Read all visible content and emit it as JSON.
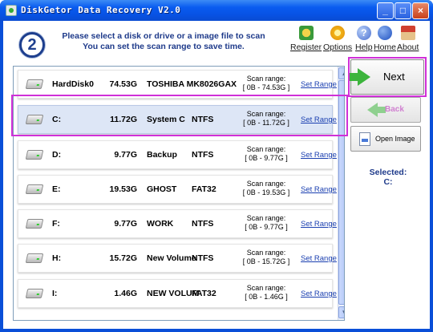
{
  "window": {
    "title": "DiskGetor Data Recovery V2.0",
    "controls": {
      "minimize": "_",
      "maximize": "□",
      "close": "×"
    }
  },
  "header": {
    "step_number": "2",
    "instructions": [
      "Please select a disk or drive or a image file to scan",
      "You can set the scan range to save time."
    ]
  },
  "menu": [
    {
      "label": "Register",
      "icon": "register-icon"
    },
    {
      "label": "Options",
      "icon": "options-icon"
    },
    {
      "label": "Help",
      "icon": "help-icon"
    },
    {
      "label": "Home",
      "icon": "home-icon"
    },
    {
      "label": "About",
      "icon": "about-icon"
    }
  ],
  "scan_range_label": "Scan range:",
  "set_range_label": "Set Range",
  "drives": [
    {
      "name": "HardDisk0",
      "size": "74.53G",
      "label": "TOSHIBA MK8026GAX",
      "fs": "",
      "range": "[ 0B - 74.53G ]"
    },
    {
      "name": "C:",
      "size": "11.72G",
      "label": "System C",
      "fs": "NTFS",
      "range": "[ 0B - 11.72G ]"
    },
    {
      "name": "D:",
      "size": "9.77G",
      "label": "Backup",
      "fs": "NTFS",
      "range": "[ 0B - 9.77G ]"
    },
    {
      "name": "E:",
      "size": "19.53G",
      "label": "GHOST",
      "fs": "FAT32",
      "range": "[ 0B - 19.53G ]"
    },
    {
      "name": "F:",
      "size": "9.77G",
      "label": "WORK",
      "fs": "NTFS",
      "range": "[ 0B - 9.77G ]"
    },
    {
      "name": "H:",
      "size": "15.72G",
      "label": "New Volume",
      "fs": "NTFS",
      "range": "[ 0B - 15.72G ]"
    },
    {
      "name": "I:",
      "size": "1.46G",
      "label": "NEW VOLUM",
      "fs": "FAT32",
      "range": "[ 0B - 1.46G ]"
    }
  ],
  "selected_index": 1,
  "buttons": {
    "next": "Next",
    "back": "Back",
    "open_image": "Open Image"
  },
  "selected": {
    "label": "Selected:",
    "value": "C:"
  },
  "colors": {
    "title_bar": "#0a5cf0",
    "accent_text": "#1e3a8a",
    "link": "#1a3fb0",
    "highlight": "#d030d8"
  }
}
